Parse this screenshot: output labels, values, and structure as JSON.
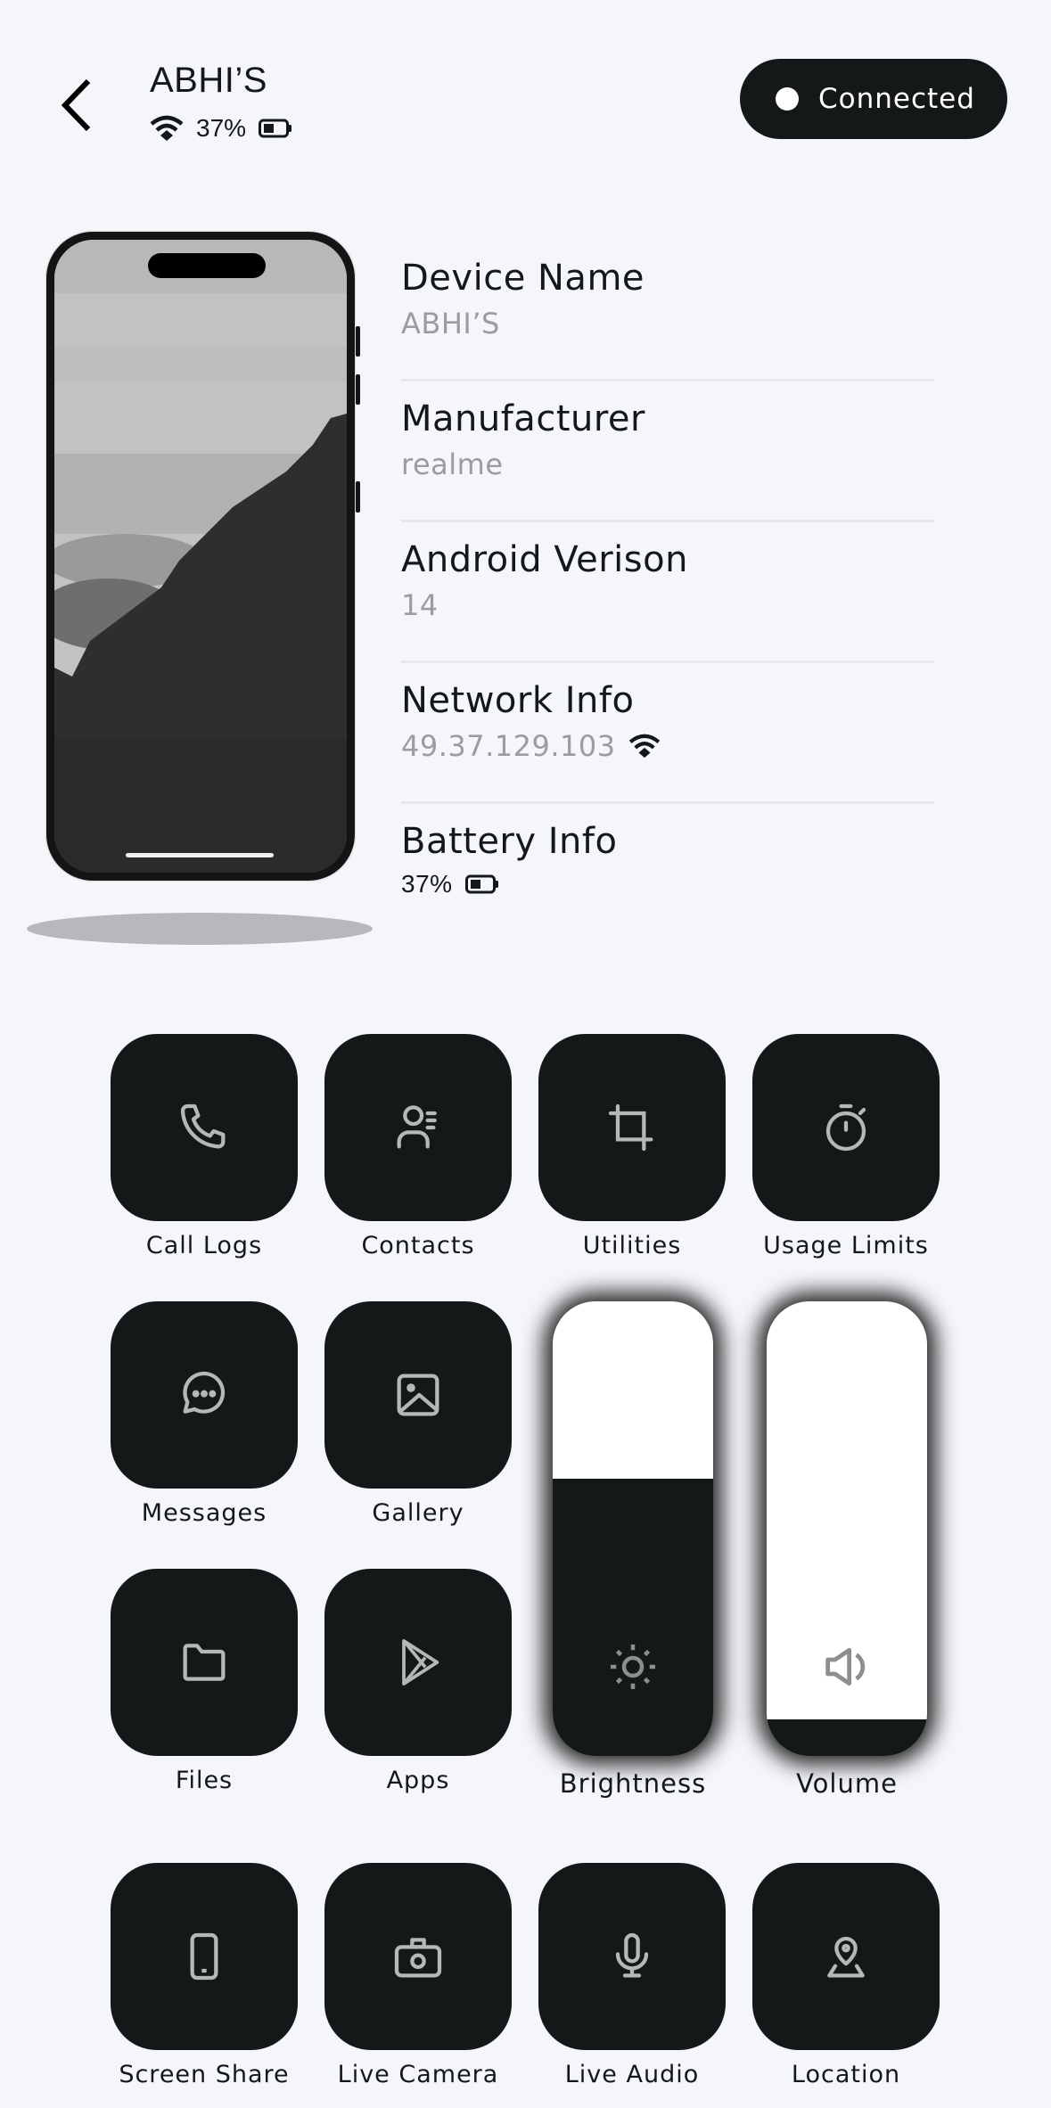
{
  "header": {
    "title": "ABHI’S",
    "battery_percent_text": "37%",
    "connection_status": "Connected"
  },
  "device_info": [
    {
      "label": "Device Name",
      "value": "ABHI’S"
    },
    {
      "label": "Manufacturer",
      "value": "realme"
    },
    {
      "label": "Android Verison",
      "value": "14"
    },
    {
      "label": "Network Info",
      "value": "49.37.129.103"
    },
    {
      "label": "Battery Info",
      "value": "37%"
    }
  ],
  "tiles": [
    {
      "label": "Call Logs",
      "icon": "phone-icon"
    },
    {
      "label": "Contacts",
      "icon": "contacts-icon"
    },
    {
      "label": "Utilities",
      "icon": "crop-icon"
    },
    {
      "label": "Usage Limits",
      "icon": "stopwatch-icon"
    },
    {
      "label": "Messages",
      "icon": "chat-bubble-icon"
    },
    {
      "label": "Gallery",
      "icon": "image-icon"
    },
    {
      "label": "Files",
      "icon": "folder-icon"
    },
    {
      "label": "Apps",
      "icon": "play-store-icon"
    },
    {
      "label": "Screen Share",
      "icon": "smartphone-icon"
    },
    {
      "label": "Live Camera",
      "icon": "camera-icon"
    },
    {
      "label": "Live Audio",
      "icon": "microphone-icon"
    },
    {
      "label": "Location",
      "icon": "location-pin-icon"
    }
  ],
  "sliders": {
    "brightness": {
      "label": "Brightness",
      "level": 0.61,
      "icon": "sun-icon"
    },
    "volume": {
      "label": "Volume",
      "level": 0.08,
      "icon": "speaker-icon"
    }
  },
  "colors": {
    "background": "#f4f6fa",
    "tile": "#151819",
    "icon": "#b5b7b8",
    "muted_text": "#9a9c9f"
  }
}
